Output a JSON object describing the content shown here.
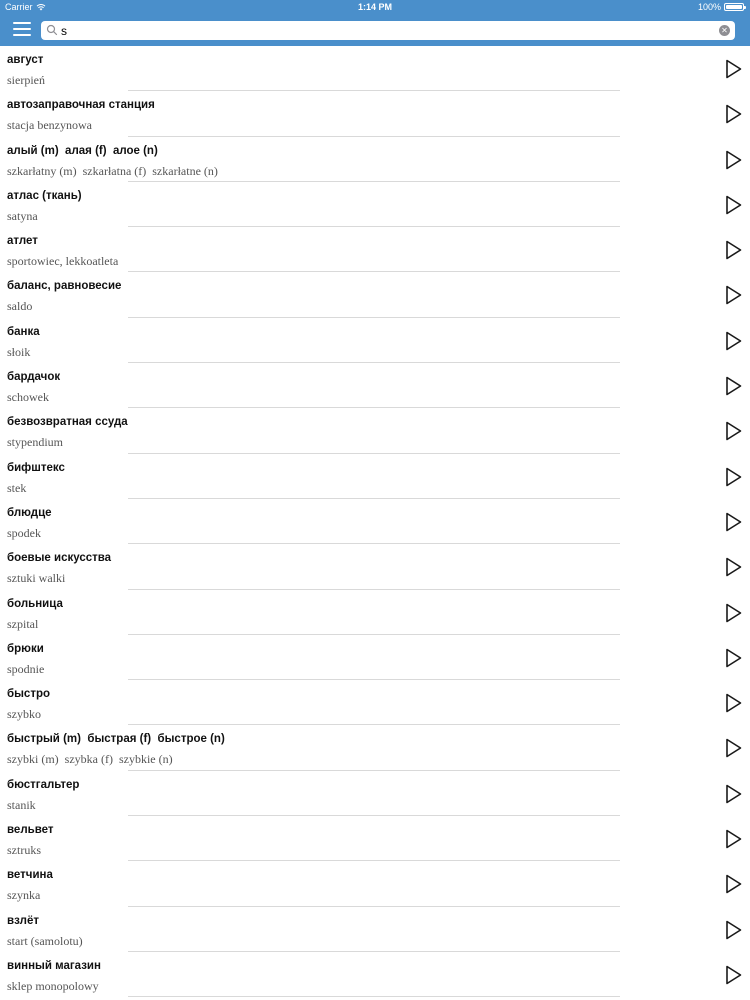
{
  "status_bar": {
    "carrier": "Carrier",
    "time": "1:14 PM",
    "battery_percent": "100%",
    "battery_level": 1.0
  },
  "search": {
    "value": "s",
    "icons": {
      "search": "search-icon",
      "clear": "clear-icon"
    }
  },
  "icons": {
    "menu": "hamburger-menu-icon",
    "play": "play-icon",
    "wifi": "wifi-icon",
    "battery": "battery-icon"
  },
  "colors": {
    "header": "#4a8fcb",
    "separator": "#d9d9d9",
    "term": "#111111",
    "translation": "#555555"
  },
  "entries": [
    {
      "term": "август",
      "translation": "sierpień"
    },
    {
      "term": "автозаправочная станция",
      "translation": "stacja benzynowa"
    },
    {
      "term": "алый (m)  алая (f)  алое (n)",
      "translation": "szkarłatny (m)  szkarłatna (f)  szkarłatne (n)"
    },
    {
      "term": "атлас (ткань)",
      "translation": "satyna"
    },
    {
      "term": "атлет",
      "translation": "sportowiec, lekkoatleta"
    },
    {
      "term": "баланс, равновесие",
      "translation": "saldo"
    },
    {
      "term": "банка",
      "translation": "słoik"
    },
    {
      "term": "бардачок",
      "translation": "schowek"
    },
    {
      "term": "безвозвратная ссуда",
      "translation": "stypendium"
    },
    {
      "term": "бифштекс",
      "translation": "stek"
    },
    {
      "term": "блюдце",
      "translation": "spodek"
    },
    {
      "term": "боевые искусства",
      "translation": "sztuki walki"
    },
    {
      "term": "больница",
      "translation": "szpital"
    },
    {
      "term": "брюки",
      "translation": "spodnie"
    },
    {
      "term": "быстро",
      "translation": "szybko"
    },
    {
      "term": "быстрый (m)  быстрая (f)  быстрое (n)",
      "translation": "szybki (m)  szybka (f)  szybkie (n)"
    },
    {
      "term": "бюстгальтер",
      "translation": "stanik"
    },
    {
      "term": "вельвет",
      "translation": "sztruks"
    },
    {
      "term": "ветчина",
      "translation": "szynka"
    },
    {
      "term": "взлёт",
      "translation": "start (samolotu)"
    },
    {
      "term": "винный магазин",
      "translation": "sklep monopolowy"
    }
  ]
}
